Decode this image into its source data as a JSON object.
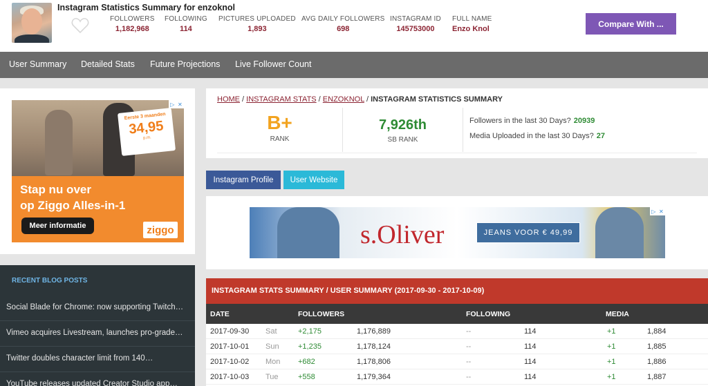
{
  "header": {
    "title": "Instagram Statistics Summary for enzoknol",
    "stats": [
      {
        "label": "FOLLOWERS",
        "value": "1,182,968"
      },
      {
        "label": "FOLLOWING",
        "value": "114"
      },
      {
        "label": "PICTURES UPLOADED",
        "value": "1,893"
      },
      {
        "label": "AVG DAILY FOLLOWERS",
        "value": "698"
      },
      {
        "label": "INSTAGRAM ID",
        "value": "145753000"
      },
      {
        "label": "FULL NAME",
        "value": "Enzo Knol"
      }
    ],
    "compare_label": "Compare With ..."
  },
  "nav": [
    "User Summary",
    "Detailed Stats",
    "Future Projections",
    "Live Follower Count"
  ],
  "ad_left": {
    "badge_top": "Eerste 3 maanden",
    "badge_price": "34,95",
    "badge_unit": "p.m.",
    "headline_1": "Stap nu over",
    "headline_2": "op Ziggo Alles-in-1",
    "cta": "Meer informatie",
    "logo": "ziggo"
  },
  "blog": {
    "heading": "RECENT BLOG POSTS",
    "items": [
      "Social Blade for Chrome: now supporting Twitch…",
      "Vimeo acquires Livestream, launches pro-grade…",
      "Twitter doubles character limit from 140…",
      "YouTube releases updated Creator Studio app…"
    ]
  },
  "breadcrumb": {
    "home": "HOME",
    "stats": "INSTAGRAM STATS",
    "user": "ENZOKNOL",
    "sep": " / ",
    "current": "INSTAGRAM STATISTICS SUMMARY"
  },
  "summary": {
    "grade": "B+",
    "grade_label": "RANK",
    "sb_rank": "7,926th",
    "sb_label": "SB RANK",
    "followers_30_label": "Followers in the last 30 Days?",
    "followers_30_value": "20939",
    "media_30_label": "Media Uploaded in the last 30 Days?",
    "media_30_value": "27"
  },
  "buttons": {
    "profile": "Instagram Profile",
    "website": "User Website"
  },
  "ad_banner": {
    "brand": "s.Oliver",
    "offer": "JEANS VOOR € 49,99"
  },
  "table": {
    "title": "INSTAGRAM STATS SUMMARY / USER SUMMARY (2017-09-30 - 2017-10-09)",
    "headers": {
      "date": "DATE",
      "followers": "FOLLOWERS",
      "following": "FOLLOWING",
      "media": "MEDIA"
    },
    "rows": [
      {
        "date": "2017-09-30",
        "day": "Sat",
        "f_delta": "+2,175",
        "followers": "1,176,889",
        "ing_delta": "--",
        "following": "114",
        "m_delta": "+1",
        "media": "1,884"
      },
      {
        "date": "2017-10-01",
        "day": "Sun",
        "f_delta": "+1,235",
        "followers": "1,178,124",
        "ing_delta": "--",
        "following": "114",
        "m_delta": "+1",
        "media": "1,885"
      },
      {
        "date": "2017-10-02",
        "day": "Mon",
        "f_delta": "+682",
        "followers": "1,178,806",
        "ing_delta": "--",
        "following": "114",
        "m_delta": "+1",
        "media": "1,886"
      },
      {
        "date": "2017-10-03",
        "day": "Tue",
        "f_delta": "+558",
        "followers": "1,179,364",
        "ing_delta": "--",
        "following": "114",
        "m_delta": "+1",
        "media": "1,887"
      }
    ]
  }
}
